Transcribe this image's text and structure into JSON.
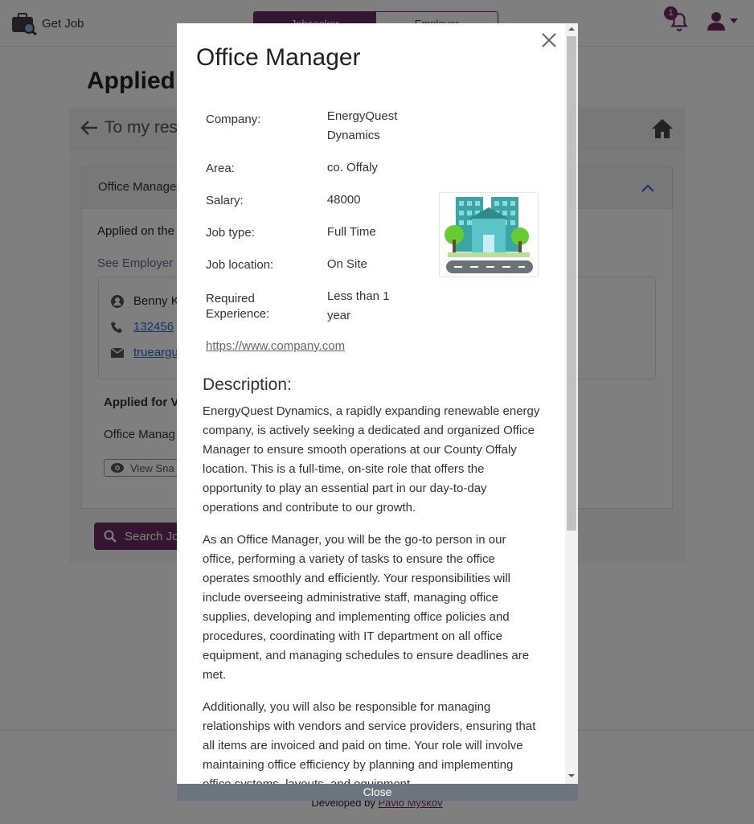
{
  "brand": {
    "name": "Get Job",
    "icon": "briefcase-search-icon"
  },
  "role_switch": {
    "jobseeker": "Jobseeker",
    "employer": "Employer"
  },
  "notifications": {
    "count": "1"
  },
  "page": {
    "title": "Applied J",
    "back_label": "To my res"
  },
  "application": {
    "header": "Office Manage",
    "applied_on": "Applied on the",
    "see_employer": "See Employer",
    "contact_name": "Benny K",
    "contact_phone": "132456",
    "contact_email": "trueargu",
    "applied_for": "Applied for V",
    "vacancy_title": "Office Manag",
    "view_snapshot": "View Sna",
    "search_jobs": "Search Jo"
  },
  "footer": {
    "developed_by": "Developed by",
    "author": "Pavlo Myskov"
  },
  "modal": {
    "title": "Office Manager",
    "fields": [
      {
        "label": "Company:",
        "value": "EnergyQuest Dynamics"
      },
      {
        "label": "Area:",
        "value": "co. Offaly"
      },
      {
        "label": "Salary:",
        "value": "48000"
      },
      {
        "label": "Job type:",
        "value": "Full Time"
      },
      {
        "label": "Job location:",
        "value": "On Site"
      },
      {
        "label": "Required Experience:",
        "value": "Less than 1 year"
      }
    ],
    "website": "https://www.company.com",
    "description_title": "Description:",
    "description": [
      "EnergyQuest Dynamics, a rapidly expanding renewable energy company, is actively seeking a dedicated and organized Office Manager to ensure smooth operations at our County Offaly location. This is a full-time, on-site role that offers the opportunity to play an essential part in our day-to-day operations and contribute to our growth.",
      "As an Office Manager, you will be the go-to person in our office, performing a variety of tasks to ensure the office operates smoothly and efficiently. Your responsibilities will include overseeing administrative staff, managing office supplies, developing and implementing office policies and procedures, coordinating with IT department on all office equipment, and managing schedules to ensure deadlines are met.",
      "Additionally, you will also be responsible for managing relationships with vendors and service providers, ensuring that all items are invoiced and paid on time. Your role will involve maintaining office efficiency by planning and implementing office systems, layouts, and equipment"
    ],
    "close_label": "Close"
  },
  "colors": {
    "brand": "#6a2c63",
    "close_bar": "#6c757d"
  }
}
